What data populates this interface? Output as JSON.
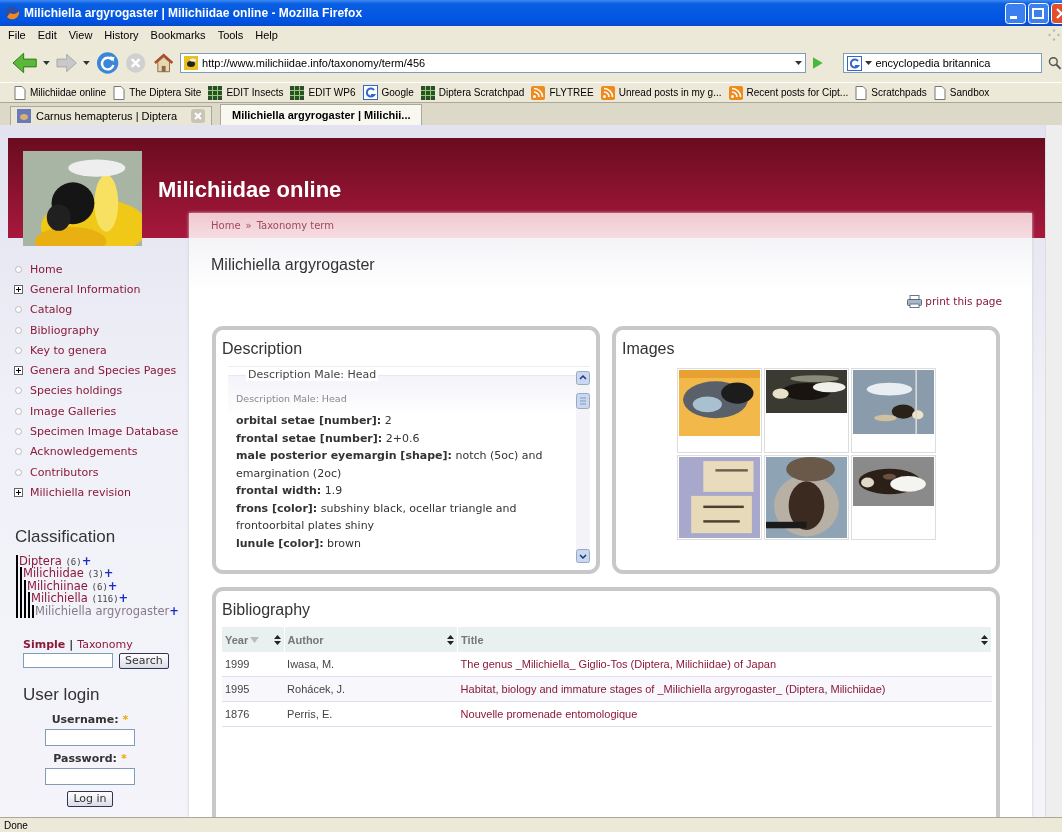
{
  "window": {
    "title": "Milichiella argyrogaster | Milichiidae online - Mozilla Firefox"
  },
  "menu": [
    "File",
    "Edit",
    "View",
    "History",
    "Bookmarks",
    "Tools",
    "Help"
  ],
  "toolbar": {
    "address": "http://www.milichiidae.info/taxonomy/term/456",
    "search": "encyclopedia britannica"
  },
  "bookmarks": [
    {
      "label": "Milichiidae online",
      "kind": "page"
    },
    {
      "label": "The Diptera Site",
      "kind": "page"
    },
    {
      "label": "EDIT Insects",
      "kind": "grid"
    },
    {
      "label": "EDIT WP6",
      "kind": "grid"
    },
    {
      "label": "Google",
      "kind": "engine"
    },
    {
      "label": "Diptera Scratchpad",
      "kind": "grid"
    },
    {
      "label": "FLYTREE",
      "kind": "feed"
    },
    {
      "label": "Unread posts in my g...",
      "kind": "feed"
    },
    {
      "label": "Recent posts for Cipt...",
      "kind": "feed"
    },
    {
      "label": "Scratchpads",
      "kind": "page"
    },
    {
      "label": "Sandbox",
      "kind": "page"
    }
  ],
  "tabs": [
    {
      "label": "Carnus hemapterus | Diptera",
      "selected": false
    },
    {
      "label": "Milichiella argyrogaster | Milichii...",
      "selected": true
    }
  ],
  "site": {
    "name": "Milichiidae online",
    "breadcrumb": [
      "Home",
      "Taxonomy term"
    ],
    "breadcrumb_separator": "»"
  },
  "sidebar": {
    "nav": [
      {
        "label": "Home",
        "kind": "leaf"
      },
      {
        "label": "General Information",
        "kind": "expandable"
      },
      {
        "label": "Catalog",
        "kind": "leaf"
      },
      {
        "label": "Bibliography",
        "kind": "leaf"
      },
      {
        "label": "Key to genera",
        "kind": "leaf"
      },
      {
        "label": "Genera and Species Pages",
        "kind": "expandable"
      },
      {
        "label": "Species holdings",
        "kind": "leaf"
      },
      {
        "label": "Image Galleries",
        "kind": "leaf"
      },
      {
        "label": "Specimen Image Database",
        "kind": "leaf"
      },
      {
        "label": "Acknowledgements",
        "kind": "leaf"
      },
      {
        "label": "Contributors",
        "kind": "leaf"
      },
      {
        "label": "Milichiella revision",
        "kind": "expandable"
      }
    ],
    "classification": {
      "title": "Classification",
      "tree": [
        {
          "label": "Diptera",
          "count": "(6)",
          "add": "+",
          "selected": false,
          "children": [
            {
              "label": "Milichiidae",
              "count": "(3)",
              "add": "+",
              "selected": false,
              "children": [
                {
                  "label": "Milichiinae",
                  "count": "(6)",
                  "add": "+",
                  "selected": false,
                  "children": [
                    {
                      "label": "Milichiella",
                      "count": "(116)",
                      "add": "+",
                      "selected": false,
                      "children": [
                        {
                          "label": "Milichiella argyrogaster",
                          "add": "+",
                          "selected": true
                        }
                      ]
                    }
                  ]
                }
              ]
            }
          ]
        }
      ]
    },
    "search": {
      "modes": [
        {
          "label": "Simple",
          "selected": true
        },
        {
          "label": "Taxonomy",
          "selected": false
        }
      ],
      "separator": "|",
      "button": "Search"
    },
    "login": {
      "title": "User login",
      "fields": [
        {
          "label": "Username:",
          "required_mark": "*"
        },
        {
          "label": "Password:",
          "required_mark": "*"
        }
      ],
      "button": "Log in"
    }
  },
  "content": {
    "title": "Milichiella argyrogaster",
    "print_link": "print this page",
    "description": {
      "title": "Description",
      "legend": "Description Male: Head",
      "subtitle": "Description Male: Head",
      "entries": [
        {
          "term": "orbital setae [number]:",
          "value": "2"
        },
        {
          "term": "frontal setae [number]:",
          "value": "2+0.6"
        },
        {
          "term": "male posterior eyemargin [shape]:",
          "value": "notch (5oc) and emargination (2oc)"
        },
        {
          "term": "frontal width:",
          "value": "1.9"
        },
        {
          "term": "frons [color]:",
          "value": "subshiny black, ocellar triangle and frontoorbital plates shiny"
        },
        {
          "term": "lunule [color]:",
          "value": "brown"
        }
      ]
    },
    "images": {
      "title": "Images"
    },
    "bibliography": {
      "title": "Bibliography",
      "columns": [
        {
          "label": "Year",
          "sorted": true
        },
        {
          "label": "Author",
          "sorted": false
        },
        {
          "label": "Title",
          "sorted": false
        }
      ],
      "rows": [
        [
          "1999",
          "Iwasa, M.",
          "The genus _Milichiella_ Giglio-Tos (Diptera, Milichiidae) of Japan"
        ],
        [
          "1995",
          "Rohácek, J.",
          "Habitat, biology and immature stages of _Milichiella argyrogaster_ (Diptera, Milichiidae)"
        ],
        [
          "1876",
          "Perris, E.",
          "Nouvelle promenade entomologique"
        ]
      ]
    }
  },
  "status_bar": {
    "text": "Done"
  }
}
